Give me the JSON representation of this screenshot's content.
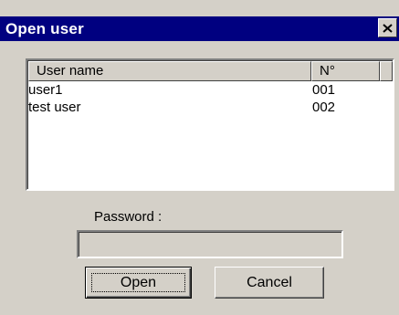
{
  "window": {
    "title": "Open user",
    "close_icon": "close-icon"
  },
  "user_list": {
    "columns": [
      "User name",
      "N°"
    ],
    "rows": [
      {
        "name": "user1",
        "number": "001"
      },
      {
        "name": "test user",
        "number": "002"
      }
    ]
  },
  "password": {
    "label": "Password :",
    "value": ""
  },
  "buttons": {
    "open_label": "Open",
    "cancel_label": "Cancel"
  },
  "colors": {
    "titlebar": "#000080",
    "face": "#d4d0c8",
    "list_background": "#ffffff"
  }
}
